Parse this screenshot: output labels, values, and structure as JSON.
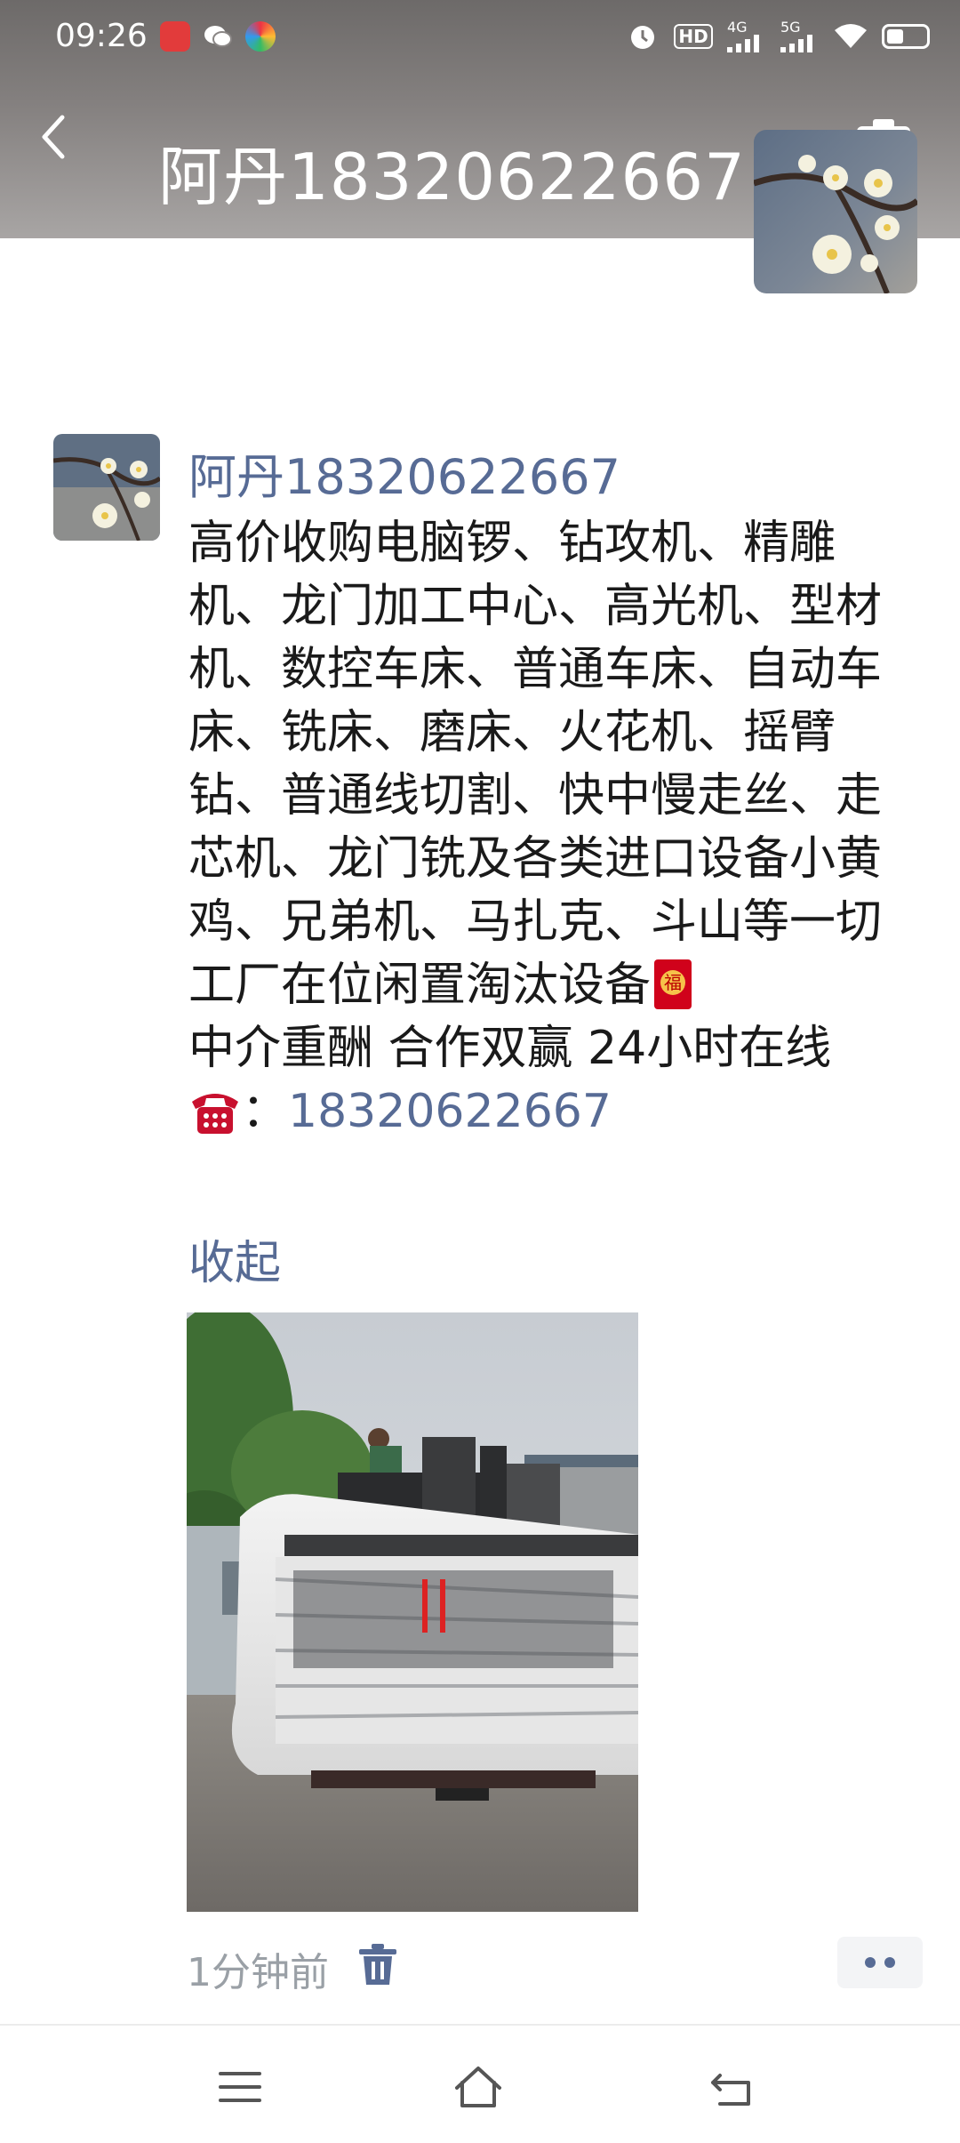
{
  "status_bar": {
    "time": "09:26",
    "notifications": [
      "app-notification-icon",
      "wechat-icon",
      "colorful-app-icon"
    ],
    "right_icons": [
      "alarm-icon",
      "hd-icon",
      "signal-4g-icon",
      "signal-5g-icon",
      "wifi-icon",
      "battery-icon"
    ],
    "hd_label": "HD",
    "net1_label": "4G",
    "net2_label": "5G"
  },
  "header": {
    "title": "阿丹18320622667",
    "back_icon": "back-chevron-icon",
    "camera_icon": "camera-icon"
  },
  "post": {
    "author": "阿丹18320622667",
    "text_main": "高价收购电脑锣、钻攻机、精雕机、龙门加工中心、高光机、型材机、数控车床、普通车床、自动车床、铣床、磨床、火花机、摇臂钻、普通线切割、快中慢走丝、走芯机、龙门铣及各类进口设备小黄鸡、兄弟机、马扎克、斗山等一切工厂在位闲置淘汰设备",
    "red_envelope_char": "福",
    "text_line2": "中介重酬 合作双赢 24小时在线",
    "phone_separator": "：",
    "phone_number": "18320622667",
    "collapse_label": "收起",
    "time_ago": "1分钟前",
    "delete_icon": "trash-icon",
    "more_icon": "more-dots-icon"
  },
  "colors": {
    "link": "#576b95",
    "text": "#1a1a1a",
    "muted": "#9aa0a6"
  },
  "nav": {
    "icons": [
      "menu-icon",
      "home-icon",
      "back-nav-icon"
    ]
  }
}
